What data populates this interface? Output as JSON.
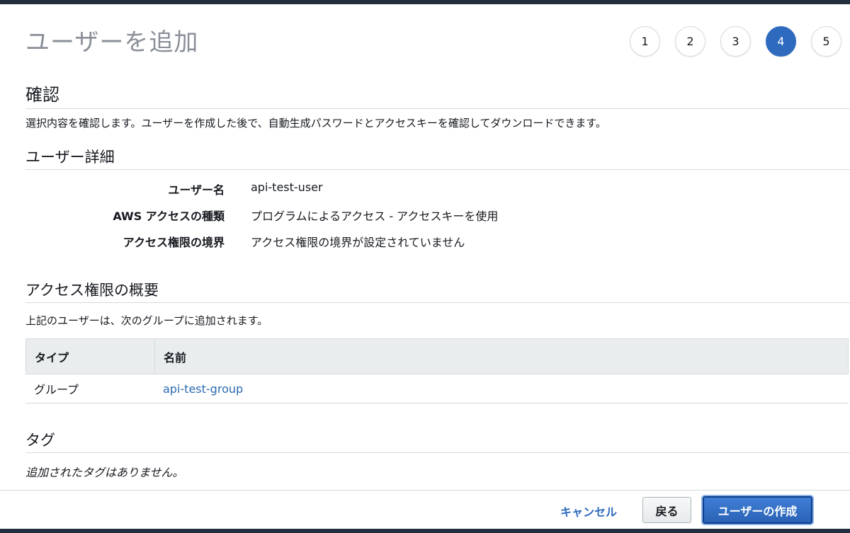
{
  "header": {
    "title": "ユーザーを追加",
    "steps": [
      {
        "label": "1",
        "active": false
      },
      {
        "label": "2",
        "active": false
      },
      {
        "label": "3",
        "active": false
      },
      {
        "label": "4",
        "active": true
      },
      {
        "label": "5",
        "active": false
      }
    ]
  },
  "review": {
    "heading": "確認",
    "description": "選択内容を確認します。ユーザーを作成した後で、自動生成パスワードとアクセスキーを確認してダウンロードできます。"
  },
  "user_details": {
    "heading": "ユーザー詳細",
    "rows": [
      {
        "key": "ユーザー名",
        "value": "api-test-user"
      },
      {
        "key": "AWS アクセスの種類",
        "value": "プログラムによるアクセス - アクセスキーを使用"
      },
      {
        "key": "アクセス権限の境界",
        "value": "アクセス権限の境界が設定されていません"
      }
    ]
  },
  "permissions": {
    "heading": "アクセス権限の概要",
    "description": "上記のユーザーは、次のグループに追加されます。",
    "table": {
      "headers": [
        "タイプ",
        "名前"
      ],
      "rows": [
        {
          "type": "グループ",
          "name": "api-test-group"
        }
      ]
    }
  },
  "tags": {
    "heading": "タグ",
    "empty_text": "追加されたタグはありません。"
  },
  "footer": {
    "cancel_label": "キャンセル",
    "back_label": "戻る",
    "create_label": "ユーザーの作成"
  },
  "colors": {
    "accent": "#2e6bbf",
    "link": "#2a6ab1",
    "frame": "#232f3e"
  }
}
